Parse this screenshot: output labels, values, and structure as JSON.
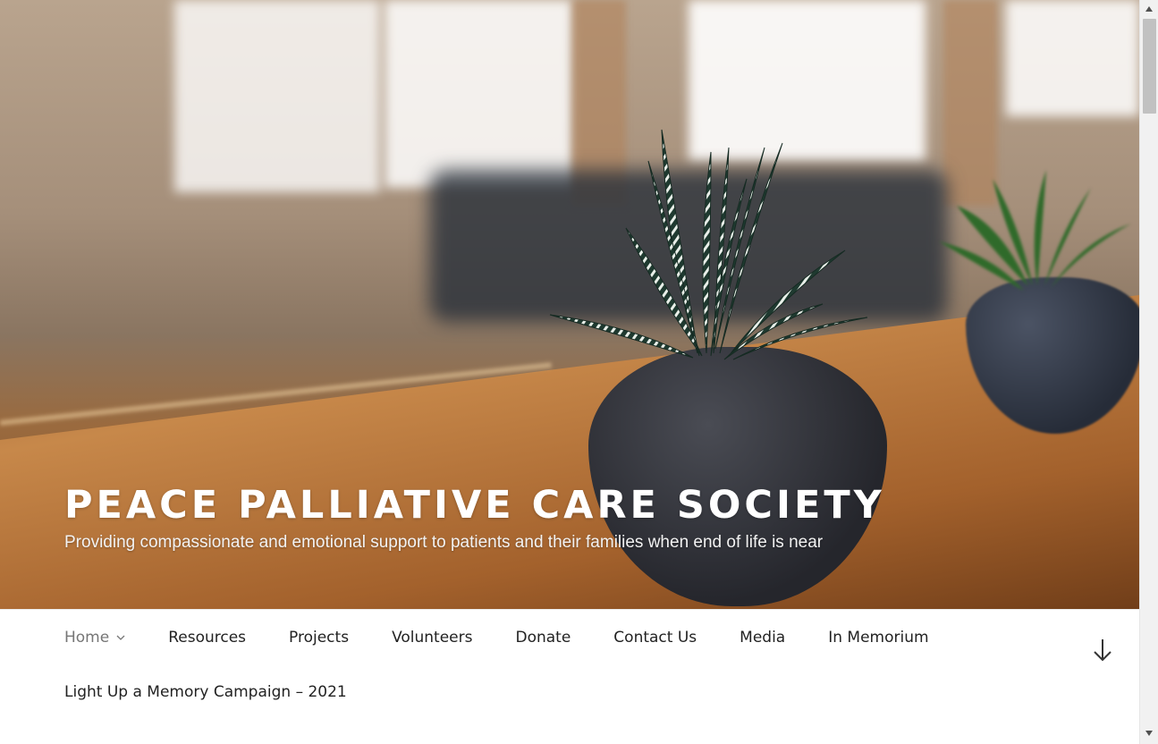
{
  "header": {
    "site_title": "PEACE PALLIATIVE CARE SOCIETY",
    "site_description": "Providing compassionate and emotional support to patients and their families when end of life is near"
  },
  "nav": {
    "items": [
      {
        "label": "Home",
        "current": true,
        "has_submenu": true
      },
      {
        "label": "Resources"
      },
      {
        "label": "Projects"
      },
      {
        "label": "Volunteers"
      },
      {
        "label": "Donate"
      },
      {
        "label": "Contact Us"
      },
      {
        "label": "Media"
      },
      {
        "label": "In Memorium"
      },
      {
        "label": "Light Up a Memory Campaign – 2021"
      }
    ],
    "scroll_icon": "arrow-down-icon"
  },
  "colors": {
    "text": "#222222",
    "current_item": "#767676",
    "title": "#ffffff"
  }
}
